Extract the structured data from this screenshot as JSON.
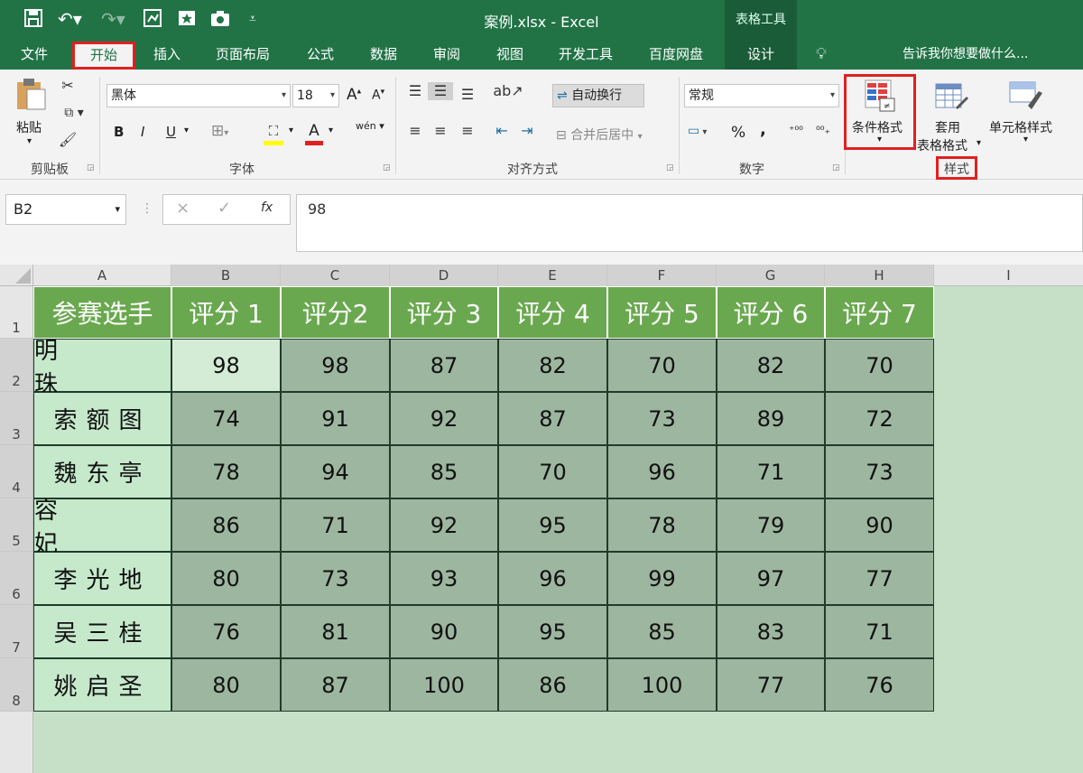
{
  "window": {
    "title": "案例.xlsx - Excel",
    "context_tools": "表格工具"
  },
  "tabs": [
    "文件",
    "开始",
    "插入",
    "页面布局",
    "公式",
    "数据",
    "审阅",
    "视图",
    "开发工具",
    "百度网盘",
    "设计"
  ],
  "tell_me": "告诉我你想要做什么...",
  "ribbon": {
    "clipboard": {
      "paste": "粘贴",
      "label": "剪贴板"
    },
    "font": {
      "name": "黑体",
      "size": "18",
      "grow": "A",
      "shrink": "A",
      "bold": "B",
      "italic": "I",
      "underline": "U",
      "wen": "wén",
      "label": "字体"
    },
    "alignment": {
      "wrap": "自动换行",
      "merge": "合并后居中",
      "label": "对齐方式"
    },
    "number": {
      "format": "常规",
      "percent": "%",
      "comma": ",",
      "label": "数字"
    },
    "styles": {
      "cond_format": "条件格式",
      "table_format_1": "套用",
      "table_format_2": "表格格式",
      "cell_style": "单元格样式",
      "label": "样式"
    }
  },
  "formula_bar": {
    "name_box": "B2",
    "value": "98",
    "cancel": "×",
    "enter": "✓",
    "fx": "fx"
  },
  "columns": [
    "A",
    "B",
    "C",
    "D",
    "E",
    "F",
    "G",
    "H",
    "I"
  ],
  "rows": [
    "1",
    "2",
    "3",
    "4",
    "5",
    "6",
    "7",
    "8"
  ],
  "table": {
    "headers": [
      "参赛选手",
      "评分 1",
      "评分2",
      "评分 3",
      "评分 4",
      "评分 5",
      "评分 6",
      "评分 7"
    ],
    "data": [
      {
        "name": "明　　珠",
        "scores": [
          "98",
          "98",
          "87",
          "82",
          "70",
          "82",
          "70"
        ]
      },
      {
        "name": "索额图",
        "scores": [
          "74",
          "91",
          "92",
          "87",
          "73",
          "89",
          "72"
        ]
      },
      {
        "name": "魏东亭",
        "scores": [
          "78",
          "94",
          "85",
          "70",
          "96",
          "71",
          "73"
        ]
      },
      {
        "name": "容　　妃",
        "scores": [
          "86",
          "71",
          "92",
          "95",
          "78",
          "79",
          "90"
        ]
      },
      {
        "name": "李光地",
        "scores": [
          "80",
          "73",
          "93",
          "96",
          "99",
          "97",
          "77"
        ]
      },
      {
        "name": "吴三桂",
        "scores": [
          "76",
          "81",
          "90",
          "95",
          "85",
          "83",
          "71"
        ]
      },
      {
        "name": "姚启圣",
        "scores": [
          "80",
          "87",
          "100",
          "86",
          "100",
          "77",
          "76"
        ]
      }
    ]
  },
  "colors": {
    "excel_green": "#217346",
    "header_fill": "#6aa84f",
    "name_fill": "#c6e9cc",
    "score_fill": "#9db69f",
    "highlight": "#e02020"
  }
}
